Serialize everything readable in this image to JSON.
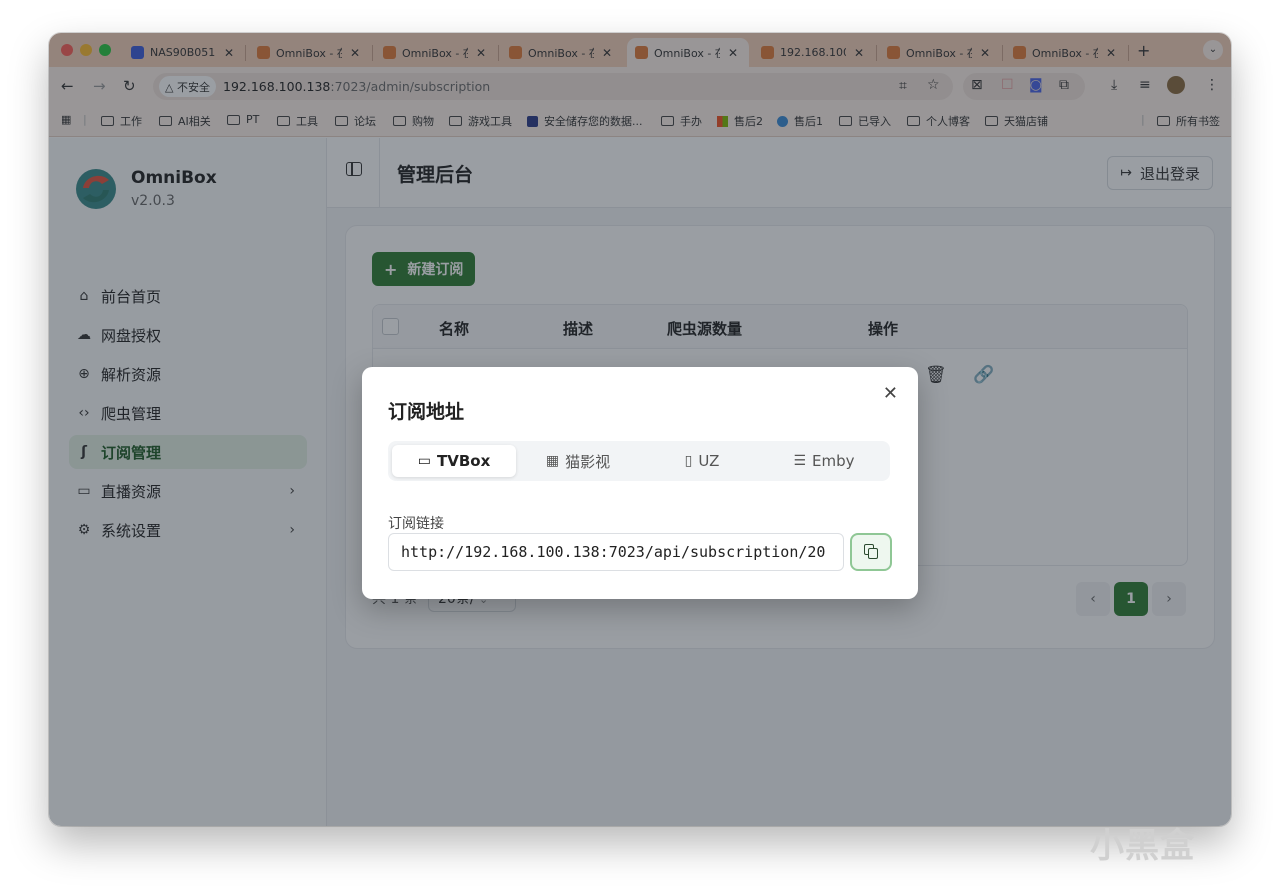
{
  "browser": {
    "tabs": [
      {
        "title": "NAS90B051",
        "active": false
      },
      {
        "title": "OmniBox - 在",
        "active": false
      },
      {
        "title": "OmniBox - 在",
        "active": false
      },
      {
        "title": "OmniBox - 在",
        "active": false
      },
      {
        "title": "OmniBox - 在",
        "active": true
      },
      {
        "title": "192.168.100.",
        "active": false
      },
      {
        "title": "OmniBox - 在",
        "active": false
      },
      {
        "title": "OmniBox - 在",
        "active": false
      }
    ],
    "new_tab": "+",
    "security_label": "△ 不安全",
    "url_host": "192.168.100.138",
    "url_rest": ":7023/admin/subscription",
    "bookmarks": [
      "工作",
      "AI相关",
      "PT",
      "工具",
      "论坛",
      "购物",
      "游戏工具",
      "安全储存您的数据...",
      "手办",
      "售后2",
      "售后1",
      "已导入",
      "个人博客",
      "天猫店铺"
    ],
    "all_bookmarks": "所有书签"
  },
  "sidebar": {
    "app_name": "OmniBox",
    "version": "v2.0.3",
    "items": [
      {
        "label": "前台首页",
        "icon": "home-icon",
        "glyph": "⌂"
      },
      {
        "label": "网盘授权",
        "icon": "cloud-icon",
        "glyph": "☁"
      },
      {
        "label": "解析资源",
        "icon": "globe-icon",
        "glyph": "⊕"
      },
      {
        "label": "爬虫管理",
        "icon": "code-icon",
        "glyph": "‹›"
      },
      {
        "label": "订阅管理",
        "icon": "rss-icon",
        "glyph": "ʃ"
      },
      {
        "label": "直播资源",
        "icon": "tv-icon",
        "glyph": "▭"
      },
      {
        "label": "系统设置",
        "icon": "gear-icon",
        "glyph": "⚙"
      }
    ]
  },
  "header": {
    "title": "管理后台",
    "logout": "退出登录"
  },
  "main": {
    "new_button": "新建订阅",
    "columns": [
      "名称",
      "描述",
      "爬虫源数量",
      "操作"
    ],
    "pager_total": "共 1 条",
    "page_size": "20条/",
    "current_page": "1"
  },
  "modal": {
    "title": "订阅地址",
    "tabs": [
      {
        "label": "TVBox",
        "icon": "tv-icon",
        "glyph": "📺"
      },
      {
        "label": "猫影视",
        "icon": "film-icon",
        "glyph": "▦"
      },
      {
        "label": "UZ",
        "icon": "phone-icon",
        "glyph": "▯"
      },
      {
        "label": "Emby",
        "icon": "server-icon",
        "glyph": "☰"
      }
    ],
    "link_label": "订阅链接",
    "link_value": "http://192.168.100.138:7023/api/subscription/20"
  },
  "watermark": "小黑盒"
}
